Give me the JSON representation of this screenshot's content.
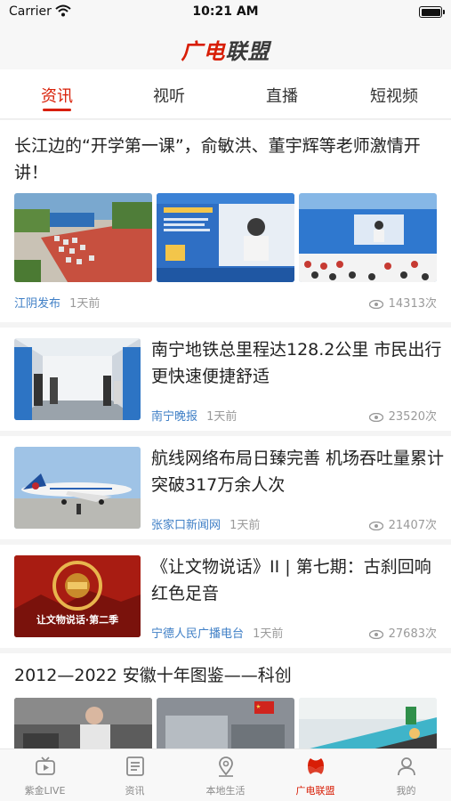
{
  "status_bar": {
    "carrier": "Carrier",
    "time": "10:21 AM"
  },
  "header": {
    "logo_part1": "广电",
    "logo_part2": "联盟"
  },
  "tabs": [
    {
      "label": "资讯",
      "active": true
    },
    {
      "label": "视听",
      "active": false
    },
    {
      "label": "直播",
      "active": false
    },
    {
      "label": "短视频",
      "active": false
    }
  ],
  "feed": [
    {
      "title": "长江边的“开学第一课”，俞敏洪、董宇辉等老师激情开讲！",
      "source": "江阴发布",
      "time": "1天前",
      "views": "14313次"
    },
    {
      "title": "南宁地铁总里程达128.2公里 市民出行更快速便捷舒适",
      "source": "南宁晚报",
      "time": "1天前",
      "views": "23520次"
    },
    {
      "title": "航线网络布局日臻完善 机场吞吐量累计突破317万余人次",
      "source": "张家口新闻网",
      "time": "1天前",
      "views": "21407次"
    },
    {
      "title": "《让文物说话》II | 第七期：古刹回响 红色足音",
      "source": "宁德人民广播电台",
      "time": "1天前",
      "views": "27683次",
      "thumb_text": "让文物说话·第二季"
    },
    {
      "title": "2012—2022 安徽十年图鉴——科创"
    }
  ],
  "tabbar": [
    {
      "label": "紫金LIVE",
      "icon": "tv-icon",
      "active": false
    },
    {
      "label": "资讯",
      "icon": "news-icon",
      "active": false
    },
    {
      "label": "本地生活",
      "icon": "location-icon",
      "active": false
    },
    {
      "label": "广电联盟",
      "icon": "alliance-icon",
      "active": true
    },
    {
      "label": "我的",
      "icon": "user-icon",
      "active": false
    }
  ],
  "colors": {
    "accent": "#d81e06",
    "source_link": "#3f7fc6",
    "meta": "#9a9a9a"
  }
}
